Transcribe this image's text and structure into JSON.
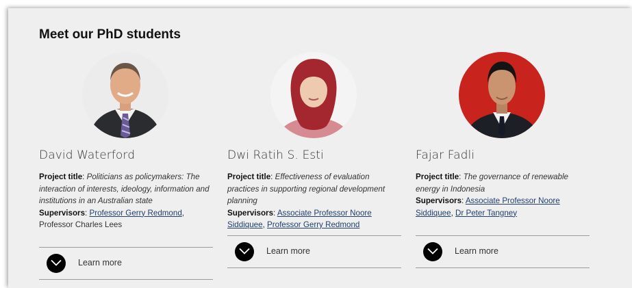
{
  "section": {
    "title": "Meet our PhD students"
  },
  "labels": {
    "project_title": "Project title",
    "supervisors": "Supervisors"
  },
  "students": [
    {
      "name": "David Waterford",
      "project": "Politicians as policymakers: The interaction of interests, ideology, information and institutions in an Australian state",
      "supervisors": [
        {
          "text": "Professor Gerry Redmond",
          "link": true
        },
        {
          "text": "Professor Charles Lees",
          "link": false
        }
      ],
      "learn_more": "Learn more"
    },
    {
      "name": "Dwi Ratih S. Esti",
      "project": "Effectiveness of evaluation practices in supporting regional development planning",
      "supervisors": [
        {
          "text": "Associate Professor Noore Siddiquee",
          "link": true
        },
        {
          "text": "Professor Gerry Redmond",
          "link": true
        }
      ],
      "learn_more": "Learn more"
    },
    {
      "name": "Fajar Fadli",
      "project": "The governance of renewable energy in Indonesia",
      "supervisors": [
        {
          "text": "Associate Professor Noore Siddiquee",
          "link": true
        },
        {
          "text": "Dr Peter Tangney",
          "link": true
        }
      ],
      "learn_more": "Learn more"
    }
  ],
  "colors": {
    "background": "#efefef",
    "link": "#1f3f6d",
    "button": "#000000",
    "photo_red": "#c8231d"
  },
  "icons": {
    "learn_more": "chevron-down-icon"
  }
}
